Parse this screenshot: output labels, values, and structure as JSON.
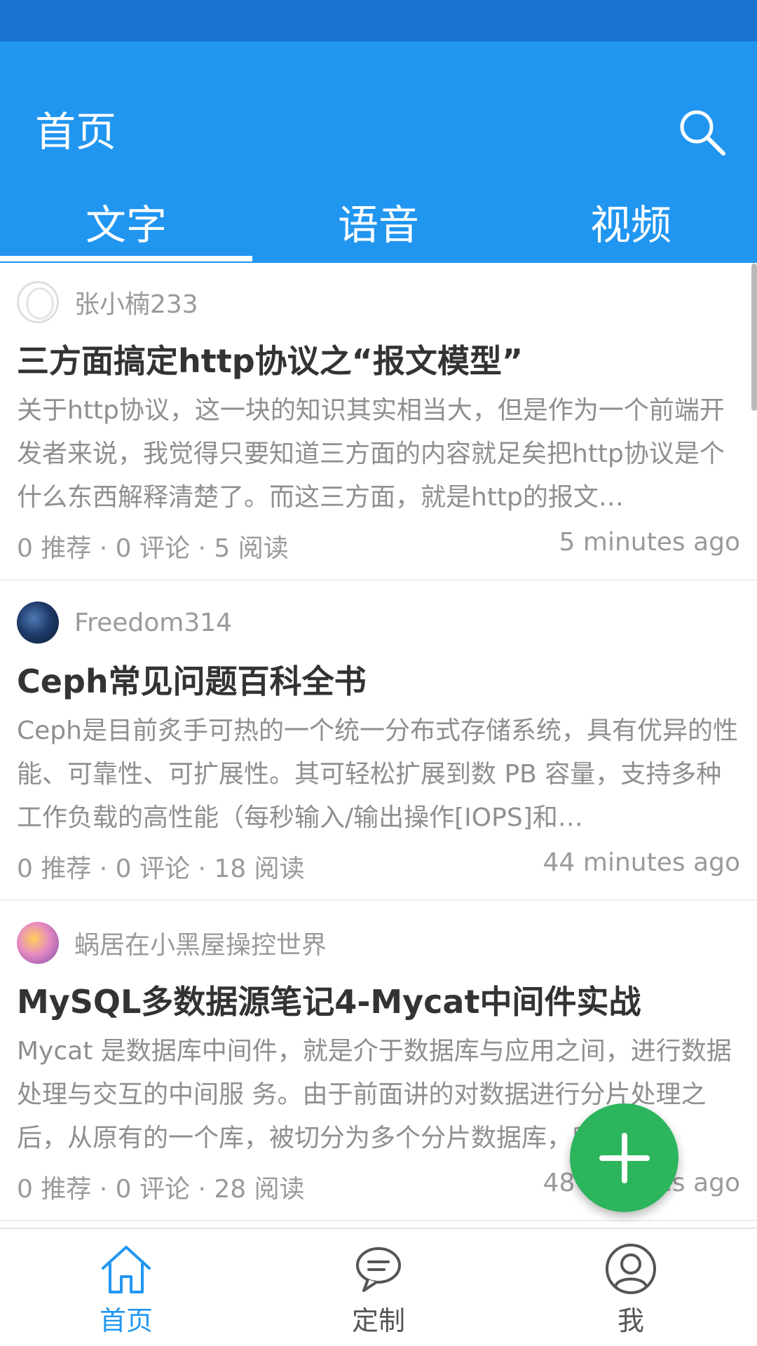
{
  "colors": {
    "status_bar": "#1a73cf",
    "app_bar": "#2196f0",
    "accent": "#2196f0",
    "fab": "#2db55d"
  },
  "header": {
    "title": "首页",
    "search_icon": "search-icon"
  },
  "tabs": [
    {
      "label": "文字",
      "selected": true
    },
    {
      "label": "语音",
      "selected": false
    },
    {
      "label": "视频",
      "selected": false
    }
  ],
  "feed": [
    {
      "author": "张小楠233",
      "avatar": "default-avatar",
      "title": "三方面搞定http协议之“报文模型”",
      "excerpt": "关于http协议，这一块的知识其实相当大，但是作为一个前端开发者来说，我觉得只要知道三方面的内容就足矣把http协议是个什么东西解释清楚了。而这三方面，就是http的报文…",
      "stats": "0 推荐 · 0 评论 · 5 阅读",
      "time": "5 minutes ago"
    },
    {
      "author": "Freedom314",
      "avatar": "space-avatar",
      "title": "Ceph常见问题百科全书",
      "excerpt": "Ceph是目前炙手可热的一个统一分布式存储系统，具有优异的性能、可靠性、可扩展性。其可轻松扩展到数 PB 容量，支持多种工作负载的高性能（每秒输入/输出操作[IOPS]和…",
      "stats": "0 推荐 · 0 评论 · 18 阅读",
      "time": "44 minutes ago"
    },
    {
      "author": "蜗居在小黑屋操控世界",
      "avatar": "colorful-avatar",
      "title": "MySQL多数据源笔记4-Mycat中间件实战",
      "excerpt": "Mycat 是数据库中间件，就是介于数据库与应用之间，进行数据处理与交互的中间服 务。由于前面讲的对数据进行分片处理之后，从原有的一个库，被切分为多个分片数据库，所有…",
      "stats": "0 推荐 · 0 评论 · 28 阅读",
      "time": "48 minutes ago"
    }
  ],
  "fab": {
    "icon": "plus-icon"
  },
  "bottom_nav": [
    {
      "label": "首页",
      "icon": "home-icon",
      "active": true
    },
    {
      "label": "定制",
      "icon": "chat-bubble-icon",
      "active": false
    },
    {
      "label": "我",
      "icon": "user-icon",
      "active": false
    }
  ]
}
